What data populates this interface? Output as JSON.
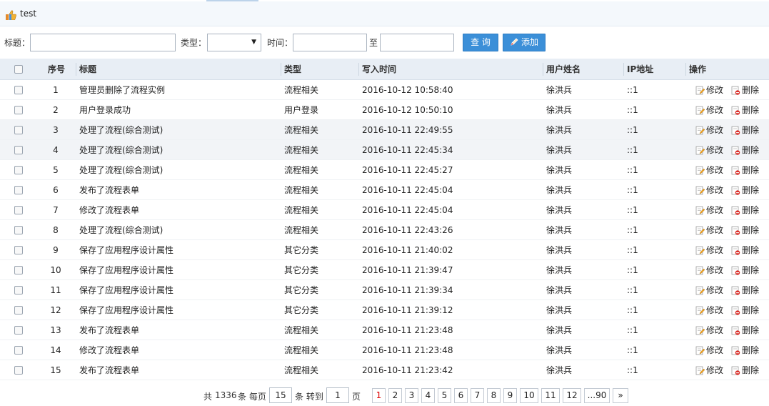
{
  "title": "test",
  "search": {
    "title_label": "标题：",
    "type_label": "类型：",
    "time_label": "时间：",
    "to_label": "至",
    "title_value": "",
    "type_value": "",
    "time_from": "",
    "time_to": "",
    "query_button": "查 询",
    "add_button": "添加"
  },
  "grid": {
    "columns": [
      "",
      "序号",
      "标题",
      "类型",
      "写入时间",
      "用户姓名",
      "IP地址",
      "操作"
    ],
    "edit_label": "修改",
    "delete_label": "删除",
    "rows": [
      {
        "no": "1",
        "title": "管理员删除了流程实例",
        "type": "流程相关",
        "time": "2016-10-12 10:58:40",
        "user": "徐洪兵",
        "ip": "::1"
      },
      {
        "no": "2",
        "title": "用户登录成功",
        "type": "用户登录",
        "time": "2016-10-12 10:50:10",
        "user": "徐洪兵",
        "ip": "::1"
      },
      {
        "no": "3",
        "title": "处理了流程(综合测试)",
        "type": "流程相关",
        "time": "2016-10-11 22:49:55",
        "user": "徐洪兵",
        "ip": "::1"
      },
      {
        "no": "4",
        "title": "处理了流程(综合测试)",
        "type": "流程相关",
        "time": "2016-10-11 22:45:34",
        "user": "徐洪兵",
        "ip": "::1"
      },
      {
        "no": "5",
        "title": "处理了流程(综合测试)",
        "type": "流程相关",
        "time": "2016-10-11 22:45:27",
        "user": "徐洪兵",
        "ip": "::1"
      },
      {
        "no": "6",
        "title": "发布了流程表单",
        "type": "流程相关",
        "time": "2016-10-11 22:45:04",
        "user": "徐洪兵",
        "ip": "::1"
      },
      {
        "no": "7",
        "title": "修改了流程表单",
        "type": "流程相关",
        "time": "2016-10-11 22:45:04",
        "user": "徐洪兵",
        "ip": "::1"
      },
      {
        "no": "8",
        "title": "处理了流程(综合测试)",
        "type": "流程相关",
        "time": "2016-10-11 22:43:26",
        "user": "徐洪兵",
        "ip": "::1"
      },
      {
        "no": "9",
        "title": "保存了应用程序设计属性",
        "type": "其它分类",
        "time": "2016-10-11 21:40:02",
        "user": "徐洪兵",
        "ip": "::1"
      },
      {
        "no": "10",
        "title": "保存了应用程序设计属性",
        "type": "其它分类",
        "time": "2016-10-11 21:39:47",
        "user": "徐洪兵",
        "ip": "::1"
      },
      {
        "no": "11",
        "title": "保存了应用程序设计属性",
        "type": "其它分类",
        "time": "2016-10-11 21:39:34",
        "user": "徐洪兵",
        "ip": "::1"
      },
      {
        "no": "12",
        "title": "保存了应用程序设计属性",
        "type": "其它分类",
        "time": "2016-10-11 21:39:12",
        "user": "徐洪兵",
        "ip": "::1"
      },
      {
        "no": "13",
        "title": "发布了流程表单",
        "type": "流程相关",
        "time": "2016-10-11 21:23:48",
        "user": "徐洪兵",
        "ip": "::1"
      },
      {
        "no": "14",
        "title": "修改了流程表单",
        "type": "流程相关",
        "time": "2016-10-11 21:23:48",
        "user": "徐洪兵",
        "ip": "::1"
      },
      {
        "no": "15",
        "title": "发布了流程表单",
        "type": "流程相关",
        "time": "2016-10-11 21:23:42",
        "user": "徐洪兵",
        "ip": "::1"
      }
    ]
  },
  "pager": {
    "total_prefix": "共",
    "total": "1336",
    "total_suffix": "条 每页",
    "page_size": "15",
    "goto_prefix": "条 转到",
    "goto_value": "1",
    "goto_suffix": "页",
    "pages": [
      "1",
      "2",
      "3",
      "4",
      "5",
      "6",
      "7",
      "8",
      "9",
      "10",
      "11",
      "12",
      "...90",
      "»"
    ],
    "current_page": "1"
  },
  "colors": {
    "accent": "#3b8fd8",
    "header_bg": "#e8eef5",
    "current_page": "#dd0000"
  }
}
